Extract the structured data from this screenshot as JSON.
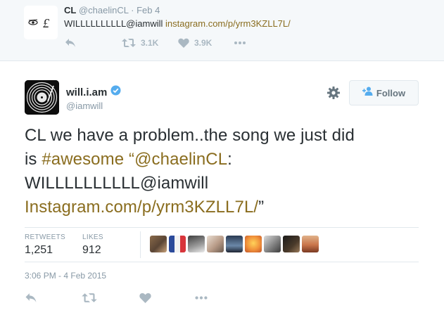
{
  "parent_tweet": {
    "name": "CL",
    "handle": "@chaelinCL",
    "separator": "·",
    "date": "Feb 4",
    "text_prefix": "WILLLLLLLLLL@iamwill",
    "text_link": "instagram.com/p/yrm3KZLL7L/",
    "retweets": "3.1K",
    "likes": "3.9K",
    "icons": [
      "reply-icon",
      "retweet-icon",
      "heart-icon",
      "more-icon"
    ]
  },
  "tweet": {
    "name": "will.i.am",
    "handle": "@iamwill",
    "follow_label": "Follow",
    "text_line1": "CL we have a problem..the song we just did",
    "text_line2_prefix": "is ",
    "text_hashtag": "#awesome",
    "text_quote_open": " “",
    "text_mention": "@chaelinCL",
    "text_colon": ":",
    "text_line3": "WILLLLLLLLLL@iamwill",
    "text_line4_link": "Instagram.com/p/yrm3KZLL7L/",
    "text_quote_close": "”",
    "retweets_label": "RETWEETS",
    "retweets_value": "1,251",
    "likes_label": "LIKES",
    "likes_value": "912",
    "timestamp": "3:06 PM - 4 Feb 2015",
    "icons": [
      "verified-icon",
      "gear-icon",
      "follow-user-icon",
      "reply-icon",
      "retweet-icon",
      "heart-icon",
      "more-icon"
    ]
  },
  "colors": {
    "link": "#8a6d1f",
    "verified": "#55acee",
    "muted": "#8899a6",
    "action_icons": "#aab8c2"
  }
}
